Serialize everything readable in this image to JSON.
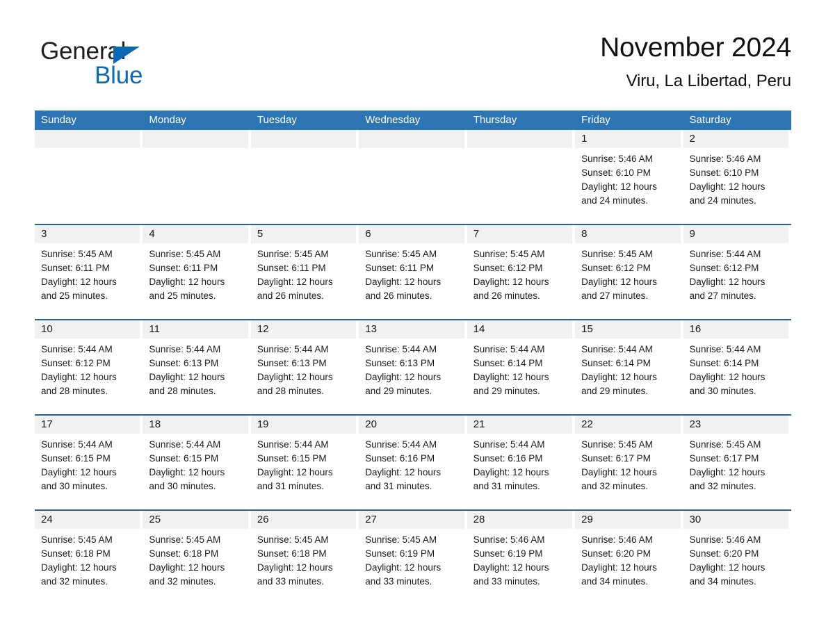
{
  "brand": {
    "name_part1": "General",
    "name_part2": "Blue",
    "triangle_color": "#0a6ab4",
    "text_color": "#231f20"
  },
  "header": {
    "title": "November 2024",
    "subtitle": "Viru, La Libertad, Peru"
  },
  "theme": {
    "header_bg": "#2c74b3",
    "header_text": "#ffffff",
    "row_divider": "#2d5f90",
    "daynum_band": "#f1f1f1",
    "body_text": "#1a1a1a",
    "page_bg": "#ffffff"
  },
  "weekday_headers": [
    "Sunday",
    "Monday",
    "Tuesday",
    "Wednesday",
    "Thursday",
    "Friday",
    "Saturday"
  ],
  "weeks": [
    [
      {
        "day": "",
        "sunrise": "",
        "sunset": "",
        "daylight1": "",
        "daylight2": "",
        "empty": true
      },
      {
        "day": "",
        "sunrise": "",
        "sunset": "",
        "daylight1": "",
        "daylight2": "",
        "empty": true
      },
      {
        "day": "",
        "sunrise": "",
        "sunset": "",
        "daylight1": "",
        "daylight2": "",
        "empty": true
      },
      {
        "day": "",
        "sunrise": "",
        "sunset": "",
        "daylight1": "",
        "daylight2": "",
        "empty": true
      },
      {
        "day": "",
        "sunrise": "",
        "sunset": "",
        "daylight1": "",
        "daylight2": "",
        "empty": true
      },
      {
        "day": "1",
        "sunrise": "Sunrise: 5:46 AM",
        "sunset": "Sunset: 6:10 PM",
        "daylight1": "Daylight: 12 hours",
        "daylight2": "and 24 minutes."
      },
      {
        "day": "2",
        "sunrise": "Sunrise: 5:46 AM",
        "sunset": "Sunset: 6:10 PM",
        "daylight1": "Daylight: 12 hours",
        "daylight2": "and 24 minutes."
      }
    ],
    [
      {
        "day": "3",
        "sunrise": "Sunrise: 5:45 AM",
        "sunset": "Sunset: 6:11 PM",
        "daylight1": "Daylight: 12 hours",
        "daylight2": "and 25 minutes."
      },
      {
        "day": "4",
        "sunrise": "Sunrise: 5:45 AM",
        "sunset": "Sunset: 6:11 PM",
        "daylight1": "Daylight: 12 hours",
        "daylight2": "and 25 minutes."
      },
      {
        "day": "5",
        "sunrise": "Sunrise: 5:45 AM",
        "sunset": "Sunset: 6:11 PM",
        "daylight1": "Daylight: 12 hours",
        "daylight2": "and 26 minutes."
      },
      {
        "day": "6",
        "sunrise": "Sunrise: 5:45 AM",
        "sunset": "Sunset: 6:11 PM",
        "daylight1": "Daylight: 12 hours",
        "daylight2": "and 26 minutes."
      },
      {
        "day": "7",
        "sunrise": "Sunrise: 5:45 AM",
        "sunset": "Sunset: 6:12 PM",
        "daylight1": "Daylight: 12 hours",
        "daylight2": "and 26 minutes."
      },
      {
        "day": "8",
        "sunrise": "Sunrise: 5:45 AM",
        "sunset": "Sunset: 6:12 PM",
        "daylight1": "Daylight: 12 hours",
        "daylight2": "and 27 minutes."
      },
      {
        "day": "9",
        "sunrise": "Sunrise: 5:44 AM",
        "sunset": "Sunset: 6:12 PM",
        "daylight1": "Daylight: 12 hours",
        "daylight2": "and 27 minutes."
      }
    ],
    [
      {
        "day": "10",
        "sunrise": "Sunrise: 5:44 AM",
        "sunset": "Sunset: 6:12 PM",
        "daylight1": "Daylight: 12 hours",
        "daylight2": "and 28 minutes."
      },
      {
        "day": "11",
        "sunrise": "Sunrise: 5:44 AM",
        "sunset": "Sunset: 6:13 PM",
        "daylight1": "Daylight: 12 hours",
        "daylight2": "and 28 minutes."
      },
      {
        "day": "12",
        "sunrise": "Sunrise: 5:44 AM",
        "sunset": "Sunset: 6:13 PM",
        "daylight1": "Daylight: 12 hours",
        "daylight2": "and 28 minutes."
      },
      {
        "day": "13",
        "sunrise": "Sunrise: 5:44 AM",
        "sunset": "Sunset: 6:13 PM",
        "daylight1": "Daylight: 12 hours",
        "daylight2": "and 29 minutes."
      },
      {
        "day": "14",
        "sunrise": "Sunrise: 5:44 AM",
        "sunset": "Sunset: 6:14 PM",
        "daylight1": "Daylight: 12 hours",
        "daylight2": "and 29 minutes."
      },
      {
        "day": "15",
        "sunrise": "Sunrise: 5:44 AM",
        "sunset": "Sunset: 6:14 PM",
        "daylight1": "Daylight: 12 hours",
        "daylight2": "and 29 minutes."
      },
      {
        "day": "16",
        "sunrise": "Sunrise: 5:44 AM",
        "sunset": "Sunset: 6:14 PM",
        "daylight1": "Daylight: 12 hours",
        "daylight2": "and 30 minutes."
      }
    ],
    [
      {
        "day": "17",
        "sunrise": "Sunrise: 5:44 AM",
        "sunset": "Sunset: 6:15 PM",
        "daylight1": "Daylight: 12 hours",
        "daylight2": "and 30 minutes."
      },
      {
        "day": "18",
        "sunrise": "Sunrise: 5:44 AM",
        "sunset": "Sunset: 6:15 PM",
        "daylight1": "Daylight: 12 hours",
        "daylight2": "and 30 minutes."
      },
      {
        "day": "19",
        "sunrise": "Sunrise: 5:44 AM",
        "sunset": "Sunset: 6:15 PM",
        "daylight1": "Daylight: 12 hours",
        "daylight2": "and 31 minutes."
      },
      {
        "day": "20",
        "sunrise": "Sunrise: 5:44 AM",
        "sunset": "Sunset: 6:16 PM",
        "daylight1": "Daylight: 12 hours",
        "daylight2": "and 31 minutes."
      },
      {
        "day": "21",
        "sunrise": "Sunrise: 5:44 AM",
        "sunset": "Sunset: 6:16 PM",
        "daylight1": "Daylight: 12 hours",
        "daylight2": "and 31 minutes."
      },
      {
        "day": "22",
        "sunrise": "Sunrise: 5:45 AM",
        "sunset": "Sunset: 6:17 PM",
        "daylight1": "Daylight: 12 hours",
        "daylight2": "and 32 minutes."
      },
      {
        "day": "23",
        "sunrise": "Sunrise: 5:45 AM",
        "sunset": "Sunset: 6:17 PM",
        "daylight1": "Daylight: 12 hours",
        "daylight2": "and 32 minutes."
      }
    ],
    [
      {
        "day": "24",
        "sunrise": "Sunrise: 5:45 AM",
        "sunset": "Sunset: 6:18 PM",
        "daylight1": "Daylight: 12 hours",
        "daylight2": "and 32 minutes."
      },
      {
        "day": "25",
        "sunrise": "Sunrise: 5:45 AM",
        "sunset": "Sunset: 6:18 PM",
        "daylight1": "Daylight: 12 hours",
        "daylight2": "and 32 minutes."
      },
      {
        "day": "26",
        "sunrise": "Sunrise: 5:45 AM",
        "sunset": "Sunset: 6:18 PM",
        "daylight1": "Daylight: 12 hours",
        "daylight2": "and 33 minutes."
      },
      {
        "day": "27",
        "sunrise": "Sunrise: 5:45 AM",
        "sunset": "Sunset: 6:19 PM",
        "daylight1": "Daylight: 12 hours",
        "daylight2": "and 33 minutes."
      },
      {
        "day": "28",
        "sunrise": "Sunrise: 5:46 AM",
        "sunset": "Sunset: 6:19 PM",
        "daylight1": "Daylight: 12 hours",
        "daylight2": "and 33 minutes."
      },
      {
        "day": "29",
        "sunrise": "Sunrise: 5:46 AM",
        "sunset": "Sunset: 6:20 PM",
        "daylight1": "Daylight: 12 hours",
        "daylight2": "and 34 minutes."
      },
      {
        "day": "30",
        "sunrise": "Sunrise: 5:46 AM",
        "sunset": "Sunset: 6:20 PM",
        "daylight1": "Daylight: 12 hours",
        "daylight2": "and 34 minutes."
      }
    ]
  ]
}
